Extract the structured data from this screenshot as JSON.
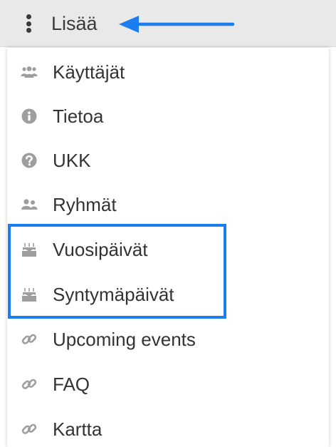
{
  "header": {
    "more_label": "Lisää",
    "more_icon": "kebab-vertical-icon",
    "arrow_color": "#1a7ef0"
  },
  "menu": {
    "items": [
      {
        "label": "Käyttäjät",
        "icon": "users-icon"
      },
      {
        "label": "Tietoa",
        "icon": "info-circle-icon"
      },
      {
        "label": "UKK",
        "icon": "question-circle-icon"
      },
      {
        "label": "Ryhmät",
        "icon": "group-icon"
      },
      {
        "label": "Vuosipäivät",
        "icon": "birthday-cake-icon"
      },
      {
        "label": "Syntymäpäivät",
        "icon": "birthday-cake-icon"
      },
      {
        "label": "Upcoming events",
        "icon": "link-icon"
      },
      {
        "label": "FAQ",
        "icon": "link-icon"
      },
      {
        "label": "Kartta",
        "icon": "link-icon"
      }
    ]
  },
  "colors": {
    "highlight": "#1a7ef0",
    "icon": "#9e9e9e",
    "text": "#333333"
  }
}
